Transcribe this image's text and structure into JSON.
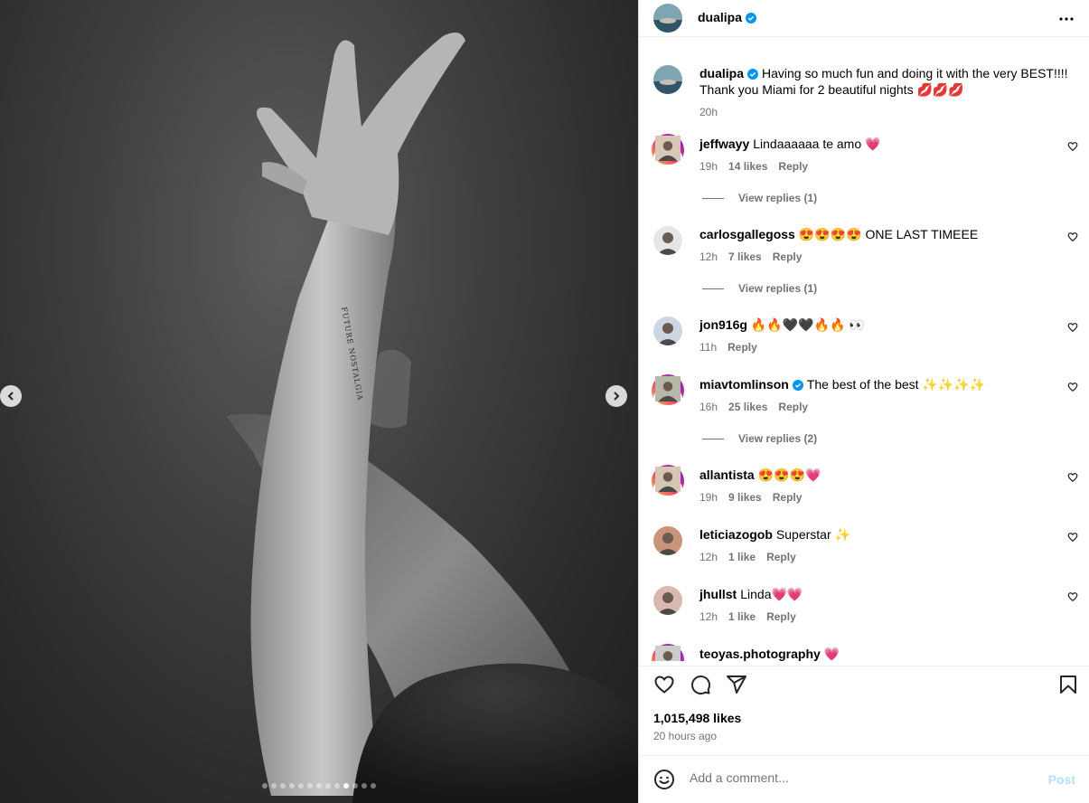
{
  "post": {
    "author": "dualipa",
    "verified": true,
    "carousel": {
      "total": 13,
      "active": 10
    }
  },
  "caption": {
    "username": "dualipa",
    "text": "Having so much fun and doing it with the very BEST!!!! Thank you Miami for 2 beautiful nights 💋💋💋",
    "time": "20h"
  },
  "comments": [
    {
      "username": "jeffwayy",
      "text": "Lindaaaaaa te amo 💗",
      "time": "19h",
      "likes": "14 likes",
      "reply": "Reply",
      "view_replies": "View replies (1)",
      "story_ring": true
    },
    {
      "username": "carlosgallegoss",
      "text": "😍😍😍😍 ONE LAST TIMEEE",
      "time": "12h",
      "likes": "7 likes",
      "reply": "Reply",
      "view_replies": "View replies (1)",
      "story_ring": false
    },
    {
      "username": "jon916g",
      "text": "🔥🔥🖤🖤🔥🔥 👀",
      "time": "11h",
      "likes": "",
      "reply": "Reply",
      "view_replies": "",
      "story_ring": false
    },
    {
      "username": "miavtomlinson",
      "verified": true,
      "text": "The best of the best ✨✨✨✨",
      "time": "16h",
      "likes": "25 likes",
      "reply": "Reply",
      "view_replies": "View replies (2)",
      "story_ring": true
    },
    {
      "username": "allantista",
      "text": "😍😍😍💗",
      "time": "19h",
      "likes": "9 likes",
      "reply": "Reply",
      "view_replies": "",
      "story_ring": true
    },
    {
      "username": "leticiazogob",
      "text": "Superstar ✨",
      "time": "12h",
      "likes": "1 like",
      "reply": "Reply",
      "view_replies": "",
      "story_ring": false
    },
    {
      "username": "jhullst",
      "text": "Linda💗💗",
      "time": "12h",
      "likes": "1 like",
      "reply": "Reply",
      "view_replies": "",
      "story_ring": false
    },
    {
      "username": "teoyas.photography",
      "text": "💗",
      "time": "",
      "likes": "",
      "reply": "",
      "view_replies": "",
      "story_ring": true
    }
  ],
  "stats": {
    "likes": "1,015,498 likes",
    "time_ago": "20 hours ago"
  },
  "composer": {
    "placeholder": "Add a comment...",
    "post_label": "Post"
  },
  "icons": {
    "more": "more-horizontal-icon",
    "like": "heart-icon",
    "comment": "comment-icon",
    "share": "share-icon",
    "save": "bookmark-icon",
    "emoji": "emoji-icon",
    "verified": "verified-badge-icon",
    "prev": "chevron-left-icon",
    "next": "chevron-right-icon"
  },
  "colors": {
    "verified": "#0095f6",
    "link_disabled": "#b2dffc",
    "muted": "#737373"
  }
}
